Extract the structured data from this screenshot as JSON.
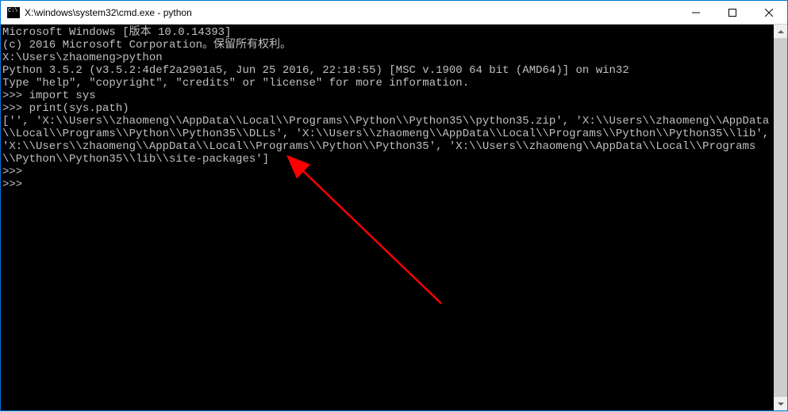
{
  "titlebar": {
    "title": "X:\\windows\\system32\\cmd.exe - python"
  },
  "terminal": {
    "lines": [
      "Microsoft Windows [版本 10.0.14393]",
      "(c) 2016 Microsoft Corporation。保留所有权利。",
      "",
      "X:\\Users\\zhaomeng>python",
      "Python 3.5.2 (v3.5.2:4def2a2901a5, Jun 25 2016, 22:18:55) [MSC v.1900 64 bit (AMD64)] on win32",
      "Type \"help\", \"copyright\", \"credits\" or \"license\" for more information.",
      ">>> import sys",
      ">>> print(sys.path)",
      "['', 'X:\\\\Users\\\\zhaomeng\\\\AppData\\\\Local\\\\Programs\\\\Python\\\\Python35\\\\python35.zip', 'X:\\\\Users\\\\zhaomeng\\\\AppData\\\\Local\\\\Programs\\\\Python\\\\Python35\\\\DLLs', 'X:\\\\Users\\\\zhaomeng\\\\AppData\\\\Local\\\\Programs\\\\Python\\\\Python35\\\\lib', 'X:\\\\Users\\\\zhaomeng\\\\AppData\\\\Local\\\\Programs\\\\Python\\\\Python35', 'X:\\\\Users\\\\zhaomeng\\\\AppData\\\\Local\\\\Programs\\\\Python\\\\Python35\\\\lib\\\\site-packages']",
      ">>>",
      ">>>"
    ]
  },
  "annotation": {
    "arrow_color": "#ff0000"
  }
}
